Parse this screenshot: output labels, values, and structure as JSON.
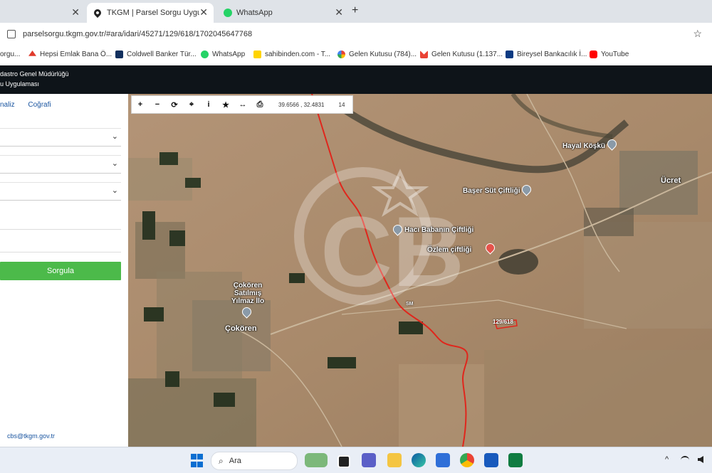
{
  "browser": {
    "tabs": [
      {
        "title": "",
        "active": false
      },
      {
        "title": "TKGM | Parsel Sorgu Uygulaması",
        "active": true
      },
      {
        "title": "WhatsApp",
        "active": false
      }
    ],
    "close_glyph": "✕",
    "new_tab_glyph": "+",
    "url": "parselsorgu.tkgm.gov.tr/#ara/idari/45271/129/618/1702045647768",
    "star_glyph": "☆",
    "bookmarks": [
      {
        "label": "orgu...",
        "icon": "page-icon",
        "color": "#5f6368"
      },
      {
        "label": "Hepsi Emlak Bana Ö...",
        "icon": "hepsiemlak-icon",
        "color": "#e03a2b"
      },
      {
        "label": "Coldwell Banker Tür...",
        "icon": "coldwell-icon",
        "color": "#12305e"
      },
      {
        "label": "WhatsApp",
        "icon": "whatsapp-icon",
        "color": "#25d366"
      },
      {
        "label": "sahibinden.com - T...",
        "icon": "sahibinden-icon",
        "color": "#ffd400"
      },
      {
        "label": "Gelen Kutusu (784)...",
        "icon": "google-icon",
        "color": "#4285f4"
      },
      {
        "label": "Gelen Kutusu (1.137...",
        "icon": "gmail-icon",
        "color": "#ea4335"
      },
      {
        "label": "Bireysel Bankacılık İ...",
        "icon": "bank-icon",
        "color": "#0b3a82"
      },
      {
        "label": "YouTube",
        "icon": "youtube-icon",
        "color": "#ff0000"
      }
    ]
  },
  "app": {
    "header_line1": "dastro Genel Müdürlüğü",
    "header_line2": "u Uygulaması",
    "panel_tabs": [
      "naliz",
      "Coğrafi"
    ],
    "chevron_glyph": "⌄",
    "search_button": "Sorgula",
    "email": "cbs@tkgm.gov.tr"
  },
  "map": {
    "toolbar": [
      "+",
      "−",
      "⟳",
      "⌖",
      "i",
      "★",
      "↔",
      "⎙"
    ],
    "coordinates": "39.6566 , 32.4831",
    "zoom_level": "14",
    "places": [
      {
        "name": "Hayal Köşkü"
      },
      {
        "name": "Ücret"
      },
      {
        "name": "Başer Süt Çiftliği"
      },
      {
        "name": "Hacı Babanın Çiftliği"
      },
      {
        "name": "Özlem çiftliği"
      },
      {
        "name": "Çokören Satılmış Yılmaz İlo"
      },
      {
        "name": "Çokören"
      }
    ],
    "parcel_label": "129/618",
    "watermark_text": "CB",
    "road_label": "SM"
  },
  "taskbar": {
    "search_placeholder": "Ara",
    "tray": {
      "up_arrow": "^",
      "wifi": "wifi-icon",
      "volume": "volume-icon"
    }
  }
}
